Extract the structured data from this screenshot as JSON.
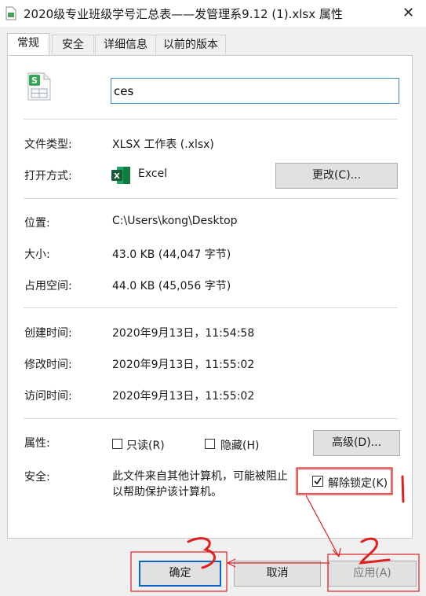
{
  "window": {
    "title": "2020级专业班级学号汇总表——发管理系9.12 (1).xlsx 属性",
    "close_glyph": "✕"
  },
  "tabs": [
    {
      "label": "常规",
      "active": true
    },
    {
      "label": "安全",
      "active": false
    },
    {
      "label": "详细信息",
      "active": false
    },
    {
      "label": "以前的版本",
      "active": false
    }
  ],
  "file": {
    "name_value": "ces",
    "icon": "spreadsheet-file-icon"
  },
  "type_section": {
    "file_type_label": "文件类型:",
    "file_type_value": "XLSX 工作表 (.xlsx)",
    "open_with_label": "打开方式:",
    "open_with_app": "Excel",
    "change_button": "更改(C)..."
  },
  "location_section": {
    "location_label": "位置:",
    "location_value": "C:\\Users\\kong\\Desktop",
    "size_label": "大小:",
    "size_value": "43.0 KB (44,047 字节)",
    "disk_size_label": "占用空间:",
    "disk_size_value": "44.0 KB (45,056 字节)"
  },
  "time_section": {
    "created_label": "创建时间:",
    "created_value": "2020年9月13日，11:54:58",
    "modified_label": "修改时间:",
    "modified_value": "2020年9月13日，11:55:02",
    "accessed_label": "访问时间:",
    "accessed_value": "2020年9月13日，11:55:02"
  },
  "attributes": {
    "label": "属性:",
    "readonly_label": "只读(R)",
    "readonly_checked": false,
    "hidden_label": "隐藏(H)",
    "hidden_checked": false,
    "advanced_button": "高级(D)..."
  },
  "security": {
    "label": "安全:",
    "text_line1": "此文件来自其他计算机，可能被阻止",
    "text_line2": "以帮助保护该计算机。",
    "unblock_label": "解除锁定(K)",
    "unblock_checked": true
  },
  "footer": {
    "ok_button": "确定",
    "cancel_button": "取消",
    "apply_button": "应用(A)"
  },
  "annotations": {
    "step1": "1",
    "step2": "2",
    "step3": "3",
    "color": "#e02020"
  },
  "colors": {
    "accent": "#0a64c8",
    "excel_green": "#1e7145",
    "file_icon_green": "#33a852"
  }
}
